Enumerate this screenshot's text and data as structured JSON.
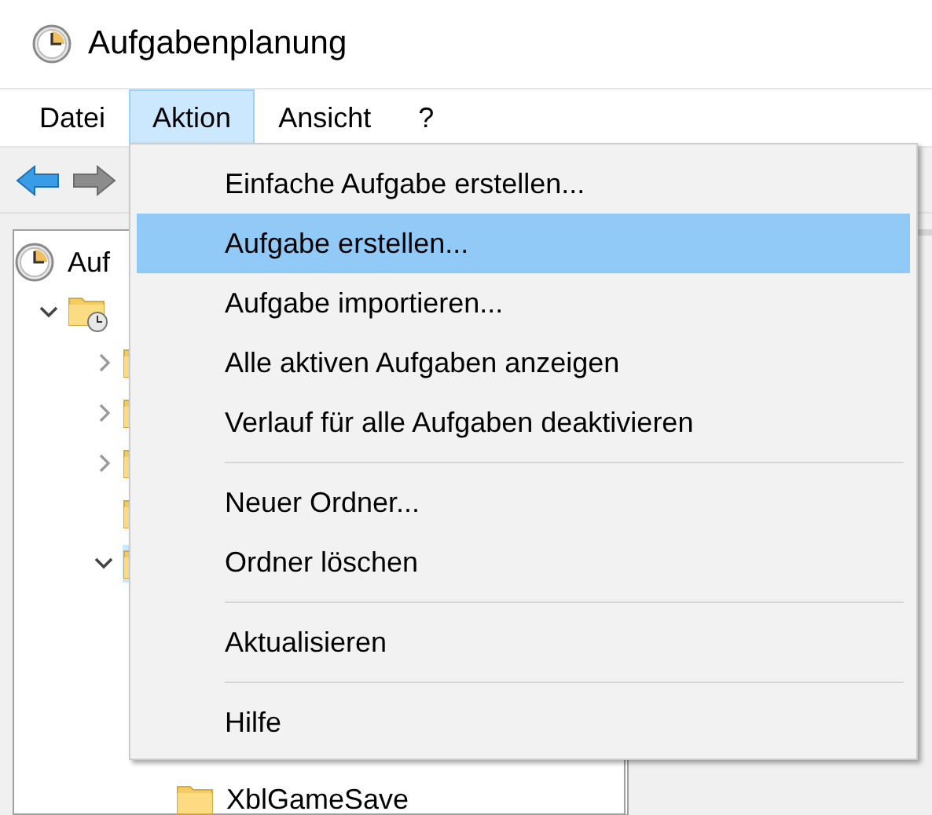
{
  "window": {
    "title": "Aufgabenplanung"
  },
  "menu_bar": [
    {
      "label": "Datei",
      "selected": false
    },
    {
      "label": "Aktion",
      "selected": true
    },
    {
      "label": "Ansicht",
      "selected": false
    },
    {
      "label": "?",
      "selected": false
    }
  ],
  "tree": [
    {
      "kind": "clock",
      "label": "Auf",
      "children": [
        {
          "kind": "clock-folder",
          "expanded": true,
          "children": [
            {
              "kind": "folder",
              "expanded": false
            },
            {
              "kind": "folder",
              "expanded": false
            },
            {
              "kind": "folder",
              "expanded": false
            },
            {
              "kind": "folder"
            },
            {
              "kind": "folder",
              "expanded": true,
              "selected": true,
              "children": [
                {
                  "kind": "folder",
                  "label": "XblGameSave"
                }
              ]
            }
          ]
        }
      ]
    }
  ],
  "menu": [
    {
      "kind": "item",
      "label": "Einfache Aufgabe erstellen...",
      "selected": false
    },
    {
      "kind": "item",
      "label": "Aufgabe erstellen...",
      "selected": true
    },
    {
      "kind": "item",
      "label": "Aufgabe importieren...",
      "selected": false
    },
    {
      "kind": "item",
      "label": "Alle aktiven Aufgaben anzeigen",
      "selected": false
    },
    {
      "kind": "item",
      "label": "Verlauf für alle Aufgaben deaktivieren",
      "selected": false
    },
    {
      "kind": "separator"
    },
    {
      "kind": "item",
      "label": "Neuer Ordner...",
      "selected": false
    },
    {
      "kind": "item",
      "label": "Ordner löschen",
      "selected": false
    },
    {
      "kind": "separator"
    },
    {
      "kind": "item",
      "label": "Aktualisieren",
      "selected": false
    },
    {
      "kind": "separator"
    },
    {
      "kind": "item",
      "label": "Hilfe",
      "selected": false
    }
  ]
}
